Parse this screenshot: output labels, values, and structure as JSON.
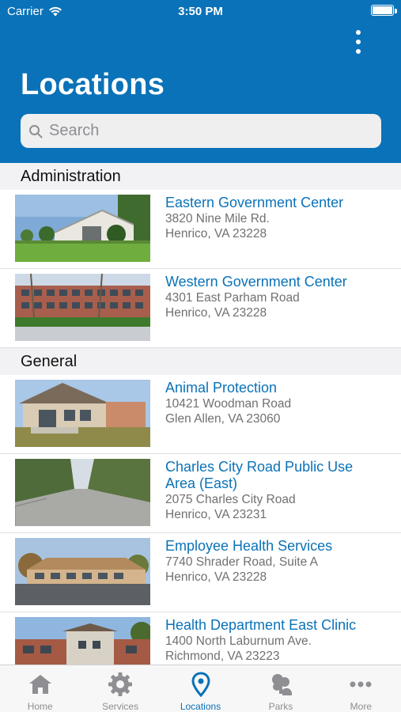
{
  "status_bar": {
    "carrier": "Carrier",
    "time": "3:50 PM"
  },
  "header": {
    "title": "Locations"
  },
  "search": {
    "placeholder": "Search"
  },
  "sections": [
    {
      "title": "Administration",
      "items": [
        {
          "name_line1": "Eastern Government Center",
          "name_line2": "",
          "address1": "3820 Nine Mile Rd.",
          "address2": "Henrico, VA 23228",
          "photo": "government-building-photo"
        },
        {
          "name_line1": "Western Government Center",
          "name_line2": "",
          "address1": "4301 East Parham Road",
          "address2": "Henrico, VA 23228",
          "photo": "brick-office-photo"
        }
      ]
    },
    {
      "title": "General",
      "items": [
        {
          "name_line1": "Animal Protection",
          "name_line2": "",
          "address1": "10421 Woodman Road",
          "address2": "Glen Allen, VA 23060",
          "photo": "shelter-building-photo"
        },
        {
          "name_line1": "Charles City Road Public Use",
          "name_line2": "Area (East)",
          "address1": "2075 Charles City Road",
          "address2": "Henrico, VA 23231",
          "photo": "road-trees-photo"
        },
        {
          "name_line1": "Employee Health Services",
          "name_line2": "",
          "address1": "7740 Shrader Road, Suite A",
          "address2": "Henrico, VA 23228",
          "photo": "low-building-photo"
        },
        {
          "name_line1": "Health Department East Clinic",
          "name_line2": "",
          "address1": "1400 North Laburnum Ave.",
          "address2": "Richmond, VA 23223",
          "photo": "clinic-building-photo"
        }
      ]
    }
  ],
  "tabs": [
    {
      "label": "Home",
      "icon": "home-icon",
      "active": false
    },
    {
      "label": "Services",
      "icon": "gear-icon",
      "active": false
    },
    {
      "label": "Locations",
      "icon": "map-pin-icon",
      "active": true
    },
    {
      "label": "Parks",
      "icon": "parks-icon",
      "active": false
    },
    {
      "label": "More",
      "icon": "more-icon",
      "active": false
    }
  ],
  "colors": {
    "brand": "#0a72b8",
    "inactive": "#8e8e93",
    "section_bg": "#f2f2f4"
  }
}
